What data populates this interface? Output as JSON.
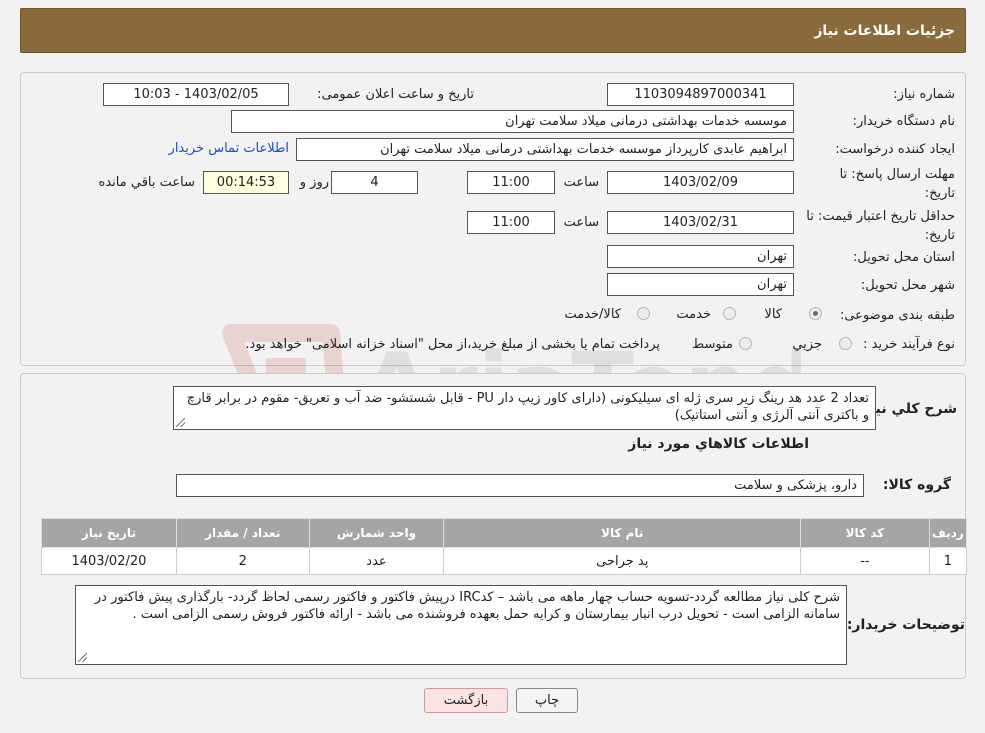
{
  "header": {
    "title": "جزئیات اطلاعات نیاز"
  },
  "fields": {
    "need_number_label": "شماره نیاز:",
    "need_number": "1103094897000341",
    "announce_label": "تاریخ و ساعت اعلان عمومی:",
    "announce_value": "1403/02/05 - 10:03",
    "buyer_org_label": "نام دستگاه خریدار:",
    "buyer_org": "موسسه خدمات بهداشتی درمانی میلاد سلامت تهران",
    "requester_label": "ایجاد کننده درخواست:",
    "requester": "ابراهیم عابدی کارپرداز موسسه خدمات بهداشتی درمانی میلاد سلامت تهران",
    "contact_link": "اطلاعات تماس خریدار",
    "deadline_label_1": "مهلت ارسال پاسخ: تا",
    "deadline_label_2": "تاریخ:",
    "deadline_date": "1403/02/09",
    "time_label": "ساعت",
    "deadline_time": "11:00",
    "days_value": "4",
    "days_label": "روز و",
    "remaining_value": "00:14:53",
    "remaining_label": "ساعت باقي مانده",
    "validity_label_1": "حداقل تاریخ اعتبار قیمت: تا",
    "validity_label_2": "تاریخ:",
    "validity_date": "1403/02/31",
    "validity_time": "11:00",
    "province_label": "استان محل تحویل:",
    "province": "تهران",
    "city_label": "شهر محل تحویل:",
    "city": "تهران",
    "category_label": "طبقه بندی موضوعی:",
    "category_options": [
      "کالا",
      "خدمت",
      "کالا/خدمت"
    ],
    "process_label": "نوع فرآیند خرید :",
    "process_options": [
      "جزیي",
      "متوسط"
    ],
    "process_note": "پرداخت تمام یا بخشی از مبلغ خرید،از محل \"اسناد خزانه اسلامی\" خواهد بود."
  },
  "description": {
    "label": "شرح کلي نياز:",
    "text": "تعداد 2 عدد هد رینگ زیر سری ژله ای سیلیکونی (دارای کاور زیپ دار PU - قابل شستشو- ضد آب و تعریق- مقوم در برابر قارچ و باکتری آنتی آلرژی و آنتی استاتیک)"
  },
  "goods": {
    "section_title": "اطلاعات کالاهاي مورد نياز",
    "group_label": "گروه کالا:",
    "group_value": "دارو، پزشکی و سلامت",
    "columns": [
      "رديف",
      "کد کالا",
      "نام کالا",
      "واحد شمارش",
      "تعداد / مقدار",
      "تاریخ نیاز"
    ],
    "rows": [
      [
        "1",
        "--",
        "پد جراحی",
        "عدد",
        "2",
        "1403/02/20"
      ]
    ]
  },
  "buyer_notes": {
    "label": "توضیحات خریدار:",
    "text": "شرح کلی نیاز مطالعه گردد-تسویه حساب چهار ماهه می باشد – کدIRC   درپیش فاکتور و فاکتور رسمی لحاظ گردد- بارگذاری پیش فاکتور در سامانه الزامی است - تحویل درب انبار بیمارستان و کرایه حمل بعهده فروشنده می باشد - ارائه فاکتور فروش رسمی الزامی است ."
  },
  "buttons": {
    "print": "چاپ",
    "back": "بازگشت"
  },
  "watermark": {
    "text": "AriaTender.neT"
  },
  "colors": {
    "header": "#8b6a3e",
    "link": "#1a4ec8",
    "table_header": "#a5a5a5"
  }
}
